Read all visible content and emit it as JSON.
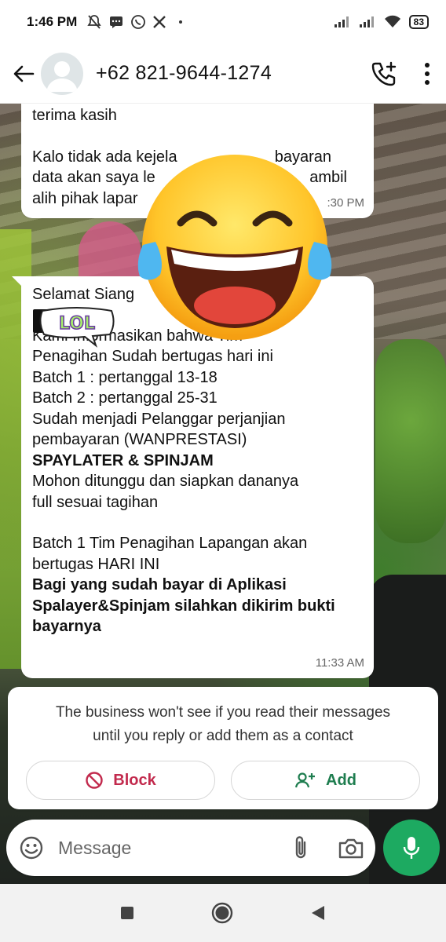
{
  "status_bar": {
    "time": "1:46 PM",
    "battery": "83"
  },
  "header": {
    "contact": "+62 821-9644-1274"
  },
  "messages": [
    {
      "lines": [
        {
          "text": "terima kasih",
          "bold": false
        },
        {
          "text": "",
          "bold": false
        },
        {
          "text": "Kalo tidak ada kejela",
          "bold": false
        },
        {
          "text": "data akan saya le",
          "bold": false
        },
        {
          "text": "alih pihak lapar",
          "bold": false
        }
      ],
      "right_fragments": [
        "bayaran",
        "ambil"
      ],
      "time": ":30 PM"
    },
    {
      "lines": [
        {
          "text": "Selamat Siang",
          "bold": false
        },
        {
          "text": "",
          "bold": false
        },
        {
          "text": "Kami Informasikan bahwa Tim",
          "bold": false
        },
        {
          "text": "Penagihan Sudah bertugas hari ini",
          "bold": false
        },
        {
          "text": "Batch 1 : pertanggal 13-18",
          "bold": false
        },
        {
          "text": "Batch 2 : pertanggal 25-31",
          "bold": false
        },
        {
          "text": "Sudah menjadi Pelanggar perjanjian",
          "bold": false
        },
        {
          "text": "pembayaran (WANPRESTASI)",
          "bold": false
        },
        {
          "text": "SPAYLATER & SPINJAM",
          "bold": true
        },
        {
          "text": "Mohon ditunggu dan siapkan dananya",
          "bold": false
        },
        {
          "text": "full sesuai tagihan",
          "bold": false
        },
        {
          "text": "",
          "bold": false
        },
        {
          "text": "Batch 1 Tim Penagihan Lapangan akan",
          "bold": false
        },
        {
          "text": "bertugas HARI INI",
          "bold": false
        },
        {
          "text": "Bagi yang sudah bayar di Aplikasi",
          "bold": true
        },
        {
          "text": "Spalayer&Spinjam silahkan dikirim bukti",
          "bold": true
        },
        {
          "text": "bayarnya",
          "bold": true
        }
      ],
      "time": "11:33 AM"
    }
  ],
  "sticker": {
    "text": "LOL"
  },
  "notice": {
    "text_line1": "The business won't see if you read their messages",
    "text_line2": "until you reply or add them as a contact",
    "block_label": "Block",
    "add_label": "Add"
  },
  "composer": {
    "placeholder": "Message"
  },
  "colors": {
    "accent_green": "#1daa61",
    "block_red": "#c22a4d",
    "add_green": "#1e7d4f"
  }
}
